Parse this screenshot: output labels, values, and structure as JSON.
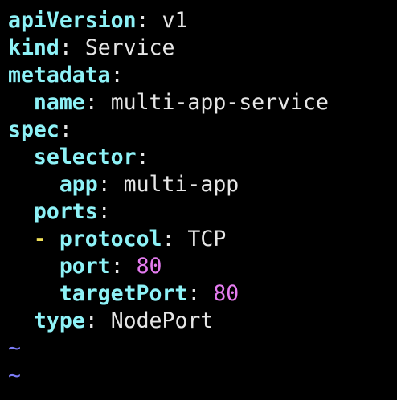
{
  "editor": {
    "lines": [
      {
        "indent": "",
        "key": "apiVersion",
        "value": "v1",
        "value_type": "string"
      },
      {
        "indent": "",
        "key": "kind",
        "value": "Service",
        "value_type": "string"
      },
      {
        "indent": "",
        "key": "metadata",
        "value": "",
        "value_type": "none"
      },
      {
        "indent": "  ",
        "key": "name",
        "value": "multi-app-service",
        "value_type": "string"
      },
      {
        "indent": "",
        "key": "spec",
        "value": "",
        "value_type": "none"
      },
      {
        "indent": "  ",
        "key": "selector",
        "value": "",
        "value_type": "none"
      },
      {
        "indent": "    ",
        "key": "app",
        "value": "multi-app",
        "value_type": "string"
      },
      {
        "indent": "  ",
        "key": "ports",
        "value": "",
        "value_type": "none"
      },
      {
        "indent": "  ",
        "dash": "- ",
        "key": "protocol",
        "value": "TCP",
        "value_type": "string"
      },
      {
        "indent": "    ",
        "key": "port",
        "value": "80",
        "value_type": "number"
      },
      {
        "indent": "    ",
        "key": "targetPort",
        "value": "80",
        "value_type": "number"
      },
      {
        "indent": "  ",
        "key": "type",
        "value": "NodePort",
        "value_type": "string"
      }
    ],
    "empty_line_markers": [
      "~",
      "~"
    ],
    "colors": {
      "background": "#000000",
      "key": "#8ef2f7",
      "text": "#e6e6e6",
      "number": "#e57cf0",
      "list_dash": "#f0e05a",
      "tilde": "#7b7bf4"
    }
  }
}
